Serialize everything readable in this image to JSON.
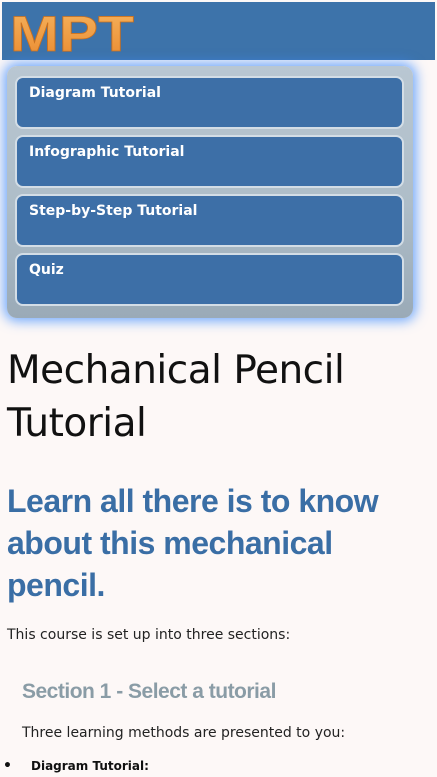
{
  "header": {
    "logo_text": "MPT",
    "logo_color": "#f0a24b",
    "background": "#3d73aa"
  },
  "nav": {
    "items": [
      {
        "label": "Diagram Tutorial"
      },
      {
        "label": "Infographic Tutorial"
      },
      {
        "label": "Step-by-Step Tutorial"
      },
      {
        "label": "Quiz"
      }
    ]
  },
  "main": {
    "title": "Mechanical Pencil Tutorial",
    "subtitle": "Learn all there is to know about this mechanical pencil.",
    "intro": "This course is set up into three sections:",
    "section1": {
      "heading": "Section 1 - Select a tutorial",
      "text": "Three learning methods are presented to you:",
      "list": [
        {
          "bullet": "•",
          "label": "Diagram Tutorial:"
        }
      ]
    }
  },
  "colors": {
    "accent": "#3a6ea5",
    "button": "#3d6fa7",
    "heading_grey": "#8a9ca6"
  }
}
